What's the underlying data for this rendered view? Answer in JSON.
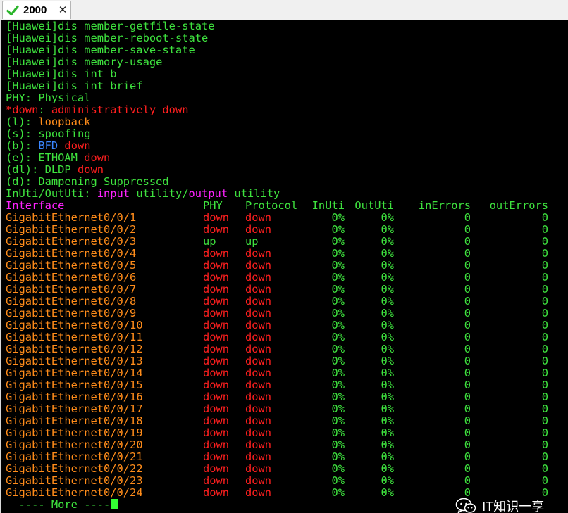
{
  "tab": {
    "title": "2000",
    "close_glyph": "✕",
    "status_icon": "checkmark-icon"
  },
  "colors": {
    "terminal_bg": "#000000",
    "green": "#3ee23e",
    "red": "#ff1f1f",
    "orange": "#ff8c1a",
    "magenta": "#ff22ff",
    "blue": "#3a86ff"
  },
  "commands": [
    "[Huawei]dis member-getfile-state",
    "[Huawei]dis member-reboot-state",
    "[Huawei]dis member-save-state",
    "[Huawei]dis memory-usage",
    "[Huawei]dis int b",
    "[Huawei]dis int brief"
  ],
  "legend": {
    "phy": "PHY: Physical",
    "admin_down_key": "*down",
    "admin_down_sep": ": ",
    "admin_down_desc": "administratively down",
    "loopback_key": "(l): ",
    "loopback_val": "loopback",
    "spoofing_key": "(s): ",
    "spoofing_val": "spoofing",
    "bfd_key": "(b): ",
    "bfd_val1": "BFD",
    "bfd_val2": " down",
    "ethoam_key": "(e): ETHOAM",
    "ethoam_val": " down",
    "dldp_key": "(dl): DLDP",
    "dldp_val": " down",
    "dampening": "(d): Dampening Suppressed",
    "util_prefix": "InUti/OutUti: ",
    "util_input": "input",
    "util_mid": " utility/",
    "util_output": "output",
    "util_suffix": " utility"
  },
  "table": {
    "headers": {
      "interface": "Interface",
      "phy": "PHY",
      "protocol": "Protocol",
      "inuti": "InUti",
      "oututi": "OutUti",
      "inerrors": "inErrors",
      "outerrors": "outErrors"
    },
    "rows": [
      {
        "interface": "GigabitEthernet0/0/1",
        "phy": "down",
        "protocol": "down",
        "inuti": "0%",
        "oututi": "0%",
        "inerrors": "0",
        "outerrors": "0"
      },
      {
        "interface": "GigabitEthernet0/0/2",
        "phy": "down",
        "protocol": "down",
        "inuti": "0%",
        "oututi": "0%",
        "inerrors": "0",
        "outerrors": "0"
      },
      {
        "interface": "GigabitEthernet0/0/3",
        "phy": "up",
        "protocol": "up",
        "inuti": "0%",
        "oututi": "0%",
        "inerrors": "0",
        "outerrors": "0"
      },
      {
        "interface": "GigabitEthernet0/0/4",
        "phy": "down",
        "protocol": "down",
        "inuti": "0%",
        "oututi": "0%",
        "inerrors": "0",
        "outerrors": "0"
      },
      {
        "interface": "GigabitEthernet0/0/5",
        "phy": "down",
        "protocol": "down",
        "inuti": "0%",
        "oututi": "0%",
        "inerrors": "0",
        "outerrors": "0"
      },
      {
        "interface": "GigabitEthernet0/0/6",
        "phy": "down",
        "protocol": "down",
        "inuti": "0%",
        "oututi": "0%",
        "inerrors": "0",
        "outerrors": "0"
      },
      {
        "interface": "GigabitEthernet0/0/7",
        "phy": "down",
        "protocol": "down",
        "inuti": "0%",
        "oututi": "0%",
        "inerrors": "0",
        "outerrors": "0"
      },
      {
        "interface": "GigabitEthernet0/0/8",
        "phy": "down",
        "protocol": "down",
        "inuti": "0%",
        "oututi": "0%",
        "inerrors": "0",
        "outerrors": "0"
      },
      {
        "interface": "GigabitEthernet0/0/9",
        "phy": "down",
        "protocol": "down",
        "inuti": "0%",
        "oututi": "0%",
        "inerrors": "0",
        "outerrors": "0"
      },
      {
        "interface": "GigabitEthernet0/0/10",
        "phy": "down",
        "protocol": "down",
        "inuti": "0%",
        "oututi": "0%",
        "inerrors": "0",
        "outerrors": "0"
      },
      {
        "interface": "GigabitEthernet0/0/11",
        "phy": "down",
        "protocol": "down",
        "inuti": "0%",
        "oututi": "0%",
        "inerrors": "0",
        "outerrors": "0"
      },
      {
        "interface": "GigabitEthernet0/0/12",
        "phy": "down",
        "protocol": "down",
        "inuti": "0%",
        "oututi": "0%",
        "inerrors": "0",
        "outerrors": "0"
      },
      {
        "interface": "GigabitEthernet0/0/13",
        "phy": "down",
        "protocol": "down",
        "inuti": "0%",
        "oututi": "0%",
        "inerrors": "0",
        "outerrors": "0"
      },
      {
        "interface": "GigabitEthernet0/0/14",
        "phy": "down",
        "protocol": "down",
        "inuti": "0%",
        "oututi": "0%",
        "inerrors": "0",
        "outerrors": "0"
      },
      {
        "interface": "GigabitEthernet0/0/15",
        "phy": "down",
        "protocol": "down",
        "inuti": "0%",
        "oututi": "0%",
        "inerrors": "0",
        "outerrors": "0"
      },
      {
        "interface": "GigabitEthernet0/0/16",
        "phy": "down",
        "protocol": "down",
        "inuti": "0%",
        "oututi": "0%",
        "inerrors": "0",
        "outerrors": "0"
      },
      {
        "interface": "GigabitEthernet0/0/17",
        "phy": "down",
        "protocol": "down",
        "inuti": "0%",
        "oututi": "0%",
        "inerrors": "0",
        "outerrors": "0"
      },
      {
        "interface": "GigabitEthernet0/0/18",
        "phy": "down",
        "protocol": "down",
        "inuti": "0%",
        "oututi": "0%",
        "inerrors": "0",
        "outerrors": "0"
      },
      {
        "interface": "GigabitEthernet0/0/19",
        "phy": "down",
        "protocol": "down",
        "inuti": "0%",
        "oututi": "0%",
        "inerrors": "0",
        "outerrors": "0"
      },
      {
        "interface": "GigabitEthernet0/0/20",
        "phy": "down",
        "protocol": "down",
        "inuti": "0%",
        "oututi": "0%",
        "inerrors": "0",
        "outerrors": "0"
      },
      {
        "interface": "GigabitEthernet0/0/21",
        "phy": "down",
        "protocol": "down",
        "inuti": "0%",
        "oututi": "0%",
        "inerrors": "0",
        "outerrors": "0"
      },
      {
        "interface": "GigabitEthernet0/0/22",
        "phy": "down",
        "protocol": "down",
        "inuti": "0%",
        "oututi": "0%",
        "inerrors": "0",
        "outerrors": "0"
      },
      {
        "interface": "GigabitEthernet0/0/23",
        "phy": "down",
        "protocol": "down",
        "inuti": "0%",
        "oututi": "0%",
        "inerrors": "0",
        "outerrors": "0"
      },
      {
        "interface": "GigabitEthernet0/0/24",
        "phy": "down",
        "protocol": "down",
        "inuti": "0%",
        "oututi": "0%",
        "inerrors": "0",
        "outerrors": "0"
      }
    ]
  },
  "pager": {
    "more": "  ---- More ----"
  },
  "watermark": {
    "text": "IT知识一享",
    "icon": "wechat-icon"
  }
}
